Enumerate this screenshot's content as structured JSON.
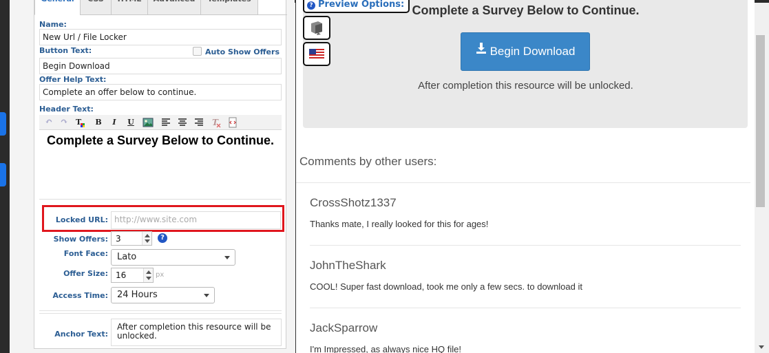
{
  "tabs": [
    "General",
    "CSS",
    "HTML",
    "Advanced",
    "Templates"
  ],
  "form": {
    "name_label": "Name:",
    "name_value": "New Url / File Locker",
    "button_text_label": "Button Text:",
    "auto_show_offers_label": "Auto Show Offers",
    "button_text_value": "Begin Download",
    "offer_help_label": "Offer Help Text:",
    "offer_help_value": "Complete an offer below to continue.",
    "header_text_label": "Header Text:",
    "header_text_value": "Complete a Survey Below to Continue.",
    "locked_url_label": "Locked URL:",
    "locked_url_placeholder": "http://www.site.com",
    "show_offers_label": "Show Offers:",
    "show_offers_value": "3",
    "font_face_label": "Font Face:",
    "font_face_value": "Lato",
    "offer_size_label": "Offer Size:",
    "offer_size_value": "16",
    "offer_size_unit": "px",
    "access_time_label": "Access Time:",
    "access_time_value": "24 Hours",
    "anchor_text_label": "Anchor Text:",
    "anchor_text_value": "After completion this resource will be unlocked."
  },
  "toolbar": {
    "bold": "B",
    "italic": "I",
    "underline": "U",
    "help_icon": "?"
  },
  "preview": {
    "options_label": "Preview Options:",
    "title": "Complete a Survey Below to Continue.",
    "download_button": "Begin Download",
    "after_text": "After completion this resource will be unlocked.",
    "comments_heading": "Comments by other users:",
    "comments": [
      {
        "user": "CrossShotz1337",
        "text": "Thanks mate, I really looked for this for ages!"
      },
      {
        "user": "JohnTheShark",
        "text": "COOL! Super fast download, took me only a few secs. to download it"
      },
      {
        "user": "JackSparrow",
        "text": "I'm Impressed, as always nice HQ file!"
      }
    ]
  },
  "colors": {
    "accent": "#2a6ebb",
    "download_button": "#3b87c8",
    "highlight_box": "#e0161d"
  }
}
